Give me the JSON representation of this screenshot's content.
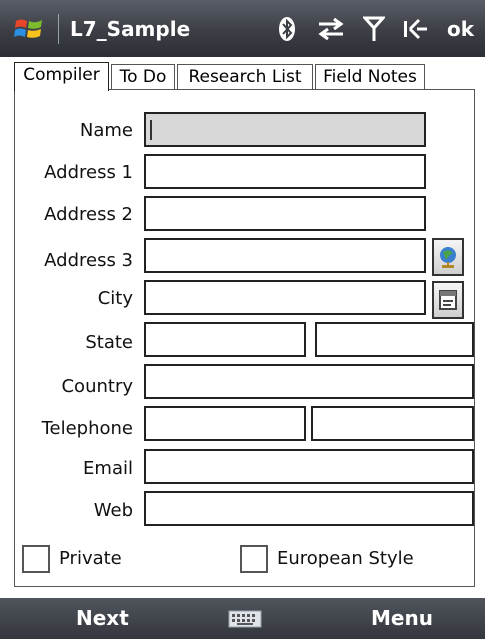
{
  "window": {
    "title": "L7_Sample",
    "ok_label": "ok"
  },
  "tabs": [
    {
      "label": "Compiler",
      "active": true
    },
    {
      "label": "To Do",
      "active": false
    },
    {
      "label": "Research List",
      "active": false
    },
    {
      "label": "Field Notes",
      "active": false
    }
  ],
  "form": {
    "name_label": "Name",
    "address1_label": "Address 1",
    "address2_label": "Address 2",
    "address3_label": "Address 3",
    "city_label": "City",
    "state_label": "State",
    "country_label": "Country",
    "telephone_label": "Telephone",
    "email_label": "Email",
    "web_label": "Web",
    "name_value": "",
    "address1_value": "",
    "address2_value": "",
    "address3_value": "",
    "city_value": "",
    "state_value": "",
    "state_code_value": "",
    "country_value": "",
    "telephone_value": "",
    "telephone_ext_value": "",
    "email_value": "",
    "web_value": ""
  },
  "checkboxes": [
    {
      "label": "Private",
      "checked": false
    },
    {
      "label": "European Style",
      "checked": false
    }
  ],
  "softkeys": {
    "left": "Next",
    "right": "Menu"
  },
  "icons": {
    "status": [
      "bluetooth-icon",
      "data-sync-icon",
      "signal-icon",
      "volume-icon"
    ],
    "buttons": [
      "globe-lookup-icon",
      "address-book-icon"
    ],
    "keyboard": "keyboard-icon"
  }
}
